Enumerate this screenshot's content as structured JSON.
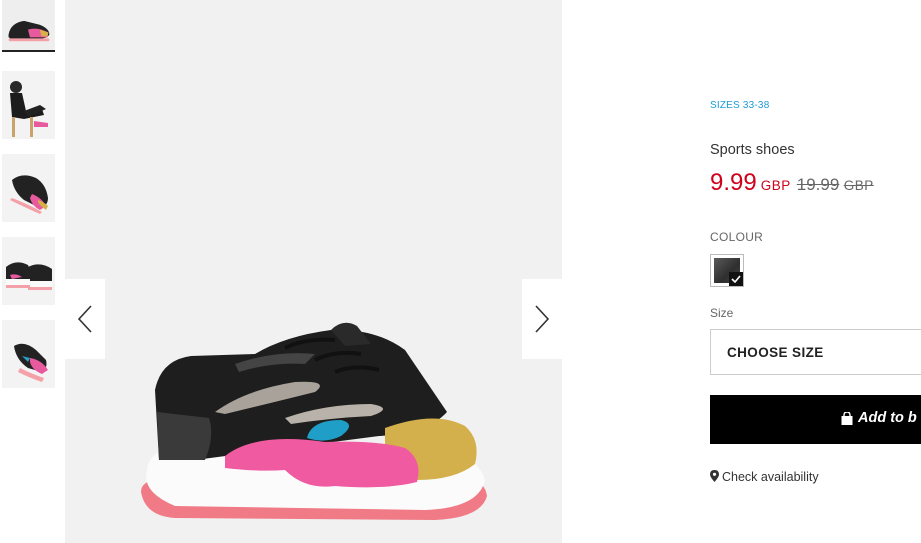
{
  "gallery": {
    "thumbnails": [
      {
        "name": "thumb-1",
        "active": true
      },
      {
        "name": "thumb-2",
        "active": false
      },
      {
        "name": "thumb-3",
        "active": false
      },
      {
        "name": "thumb-4",
        "active": false
      },
      {
        "name": "thumb-5",
        "active": false
      }
    ],
    "prev_icon": "chevron-left-icon",
    "next_icon": "chevron-right-icon"
  },
  "product": {
    "sizes_range": "SIZES 33-38",
    "title": "Sports shoes",
    "price": {
      "current": "9.99",
      "current_currency": "GBP",
      "old": "19.99",
      "old_currency": "GBP",
      "current_color": "#d0021b"
    },
    "colour_label": "COLOUR",
    "colour_selected": "dark grey",
    "size_label": "Size",
    "size_select_value": "CHOOSE SIZE",
    "add_to_bag_label": "Add to b",
    "check_availability_label": "Check availability",
    "accent_color": "#1a9bd7"
  }
}
